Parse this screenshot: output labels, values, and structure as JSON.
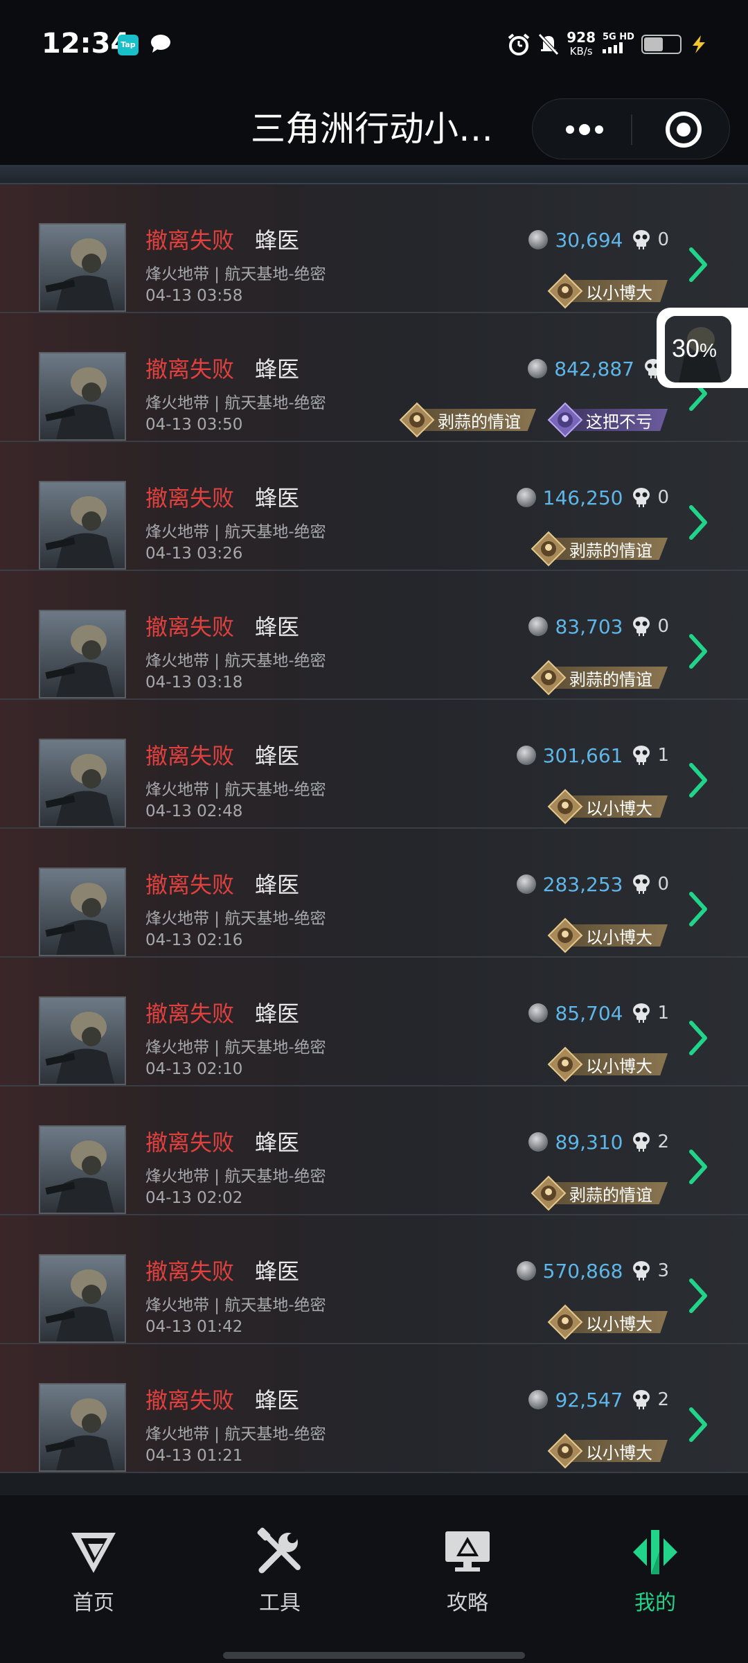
{
  "status_bar": {
    "time": "12:34",
    "tap_label": "Tap",
    "net_speed": "928",
    "net_speed_unit": "KB/s",
    "network": "5G HD",
    "battery_level": 0.5
  },
  "header": {
    "title": "三角洲行动小…"
  },
  "records": [
    {
      "status": "撤离失败",
      "role": "蜂医",
      "map": "烽火地带 | 航天基地-绝密",
      "time": "04-13 03:58",
      "value": "30,694",
      "kills": "0",
      "badges": [
        {
          "label": "以小博大",
          "style": "gold"
        }
      ]
    },
    {
      "status": "撤离失败",
      "role": "蜂医",
      "map": "烽火地带 | 航天基地-绝密",
      "time": "04-13 03:50",
      "value": "842,887",
      "kills": "",
      "badges": [
        {
          "label": "剥蒜的情谊",
          "style": "gold"
        },
        {
          "label": "这把不亏",
          "style": "purple"
        }
      ]
    },
    {
      "status": "撤离失败",
      "role": "蜂医",
      "map": "烽火地带 | 航天基地-绝密",
      "time": "04-13 03:26",
      "value": "146,250",
      "kills": "0",
      "badges": [
        {
          "label": "剥蒜的情谊",
          "style": "gold"
        }
      ]
    },
    {
      "status": "撤离失败",
      "role": "蜂医",
      "map": "烽火地带 | 航天基地-绝密",
      "time": "04-13 03:18",
      "value": "83,703",
      "kills": "0",
      "badges": [
        {
          "label": "剥蒜的情谊",
          "style": "gold"
        }
      ]
    },
    {
      "status": "撤离失败",
      "role": "蜂医",
      "map": "烽火地带 | 航天基地-绝密",
      "time": "04-13 02:48",
      "value": "301,661",
      "kills": "1",
      "badges": [
        {
          "label": "以小博大",
          "style": "gold"
        }
      ]
    },
    {
      "status": "撤离失败",
      "role": "蜂医",
      "map": "烽火地带 | 航天基地-绝密",
      "time": "04-13 02:16",
      "value": "283,253",
      "kills": "0",
      "badges": [
        {
          "label": "以小博大",
          "style": "gold"
        }
      ]
    },
    {
      "status": "撤离失败",
      "role": "蜂医",
      "map": "烽火地带 | 航天基地-绝密",
      "time": "04-13 02:10",
      "value": "85,704",
      "kills": "1",
      "badges": [
        {
          "label": "以小博大",
          "style": "gold"
        }
      ]
    },
    {
      "status": "撤离失败",
      "role": "蜂医",
      "map": "烽火地带 | 航天基地-绝密",
      "time": "04-13 02:02",
      "value": "89,310",
      "kills": "2",
      "badges": [
        {
          "label": "剥蒜的情谊",
          "style": "gold"
        }
      ]
    },
    {
      "status": "撤离失败",
      "role": "蜂医",
      "map": "烽火地带 | 航天基地-绝密",
      "time": "04-13 01:42",
      "value": "570,868",
      "kills": "3",
      "badges": [
        {
          "label": "以小博大",
          "style": "gold"
        }
      ]
    },
    {
      "status": "撤离失败",
      "role": "蜂医",
      "map": "烽火地带 | 航天基地-绝密",
      "time": "04-13 01:21",
      "value": "92,547",
      "kills": "2",
      "badges": [
        {
          "label": "以小博大",
          "style": "gold"
        }
      ]
    }
  ],
  "floating_widget": {
    "value": "30",
    "unit": "%"
  },
  "tabs": [
    {
      "label": "首页",
      "icon": "home-logo-icon",
      "active": false
    },
    {
      "label": "工具",
      "icon": "tools-icon",
      "active": false
    },
    {
      "label": "攻略",
      "icon": "guide-monitor-icon",
      "active": false
    },
    {
      "label": "我的",
      "icon": "profile-logo-icon",
      "active": true
    }
  ],
  "colors": {
    "accent": "#22d48a",
    "fail_red": "#e0413f",
    "value_blue": "#5fb6e8",
    "badge_gold": "#8a7550",
    "badge_purple": "#6d5c9e"
  }
}
